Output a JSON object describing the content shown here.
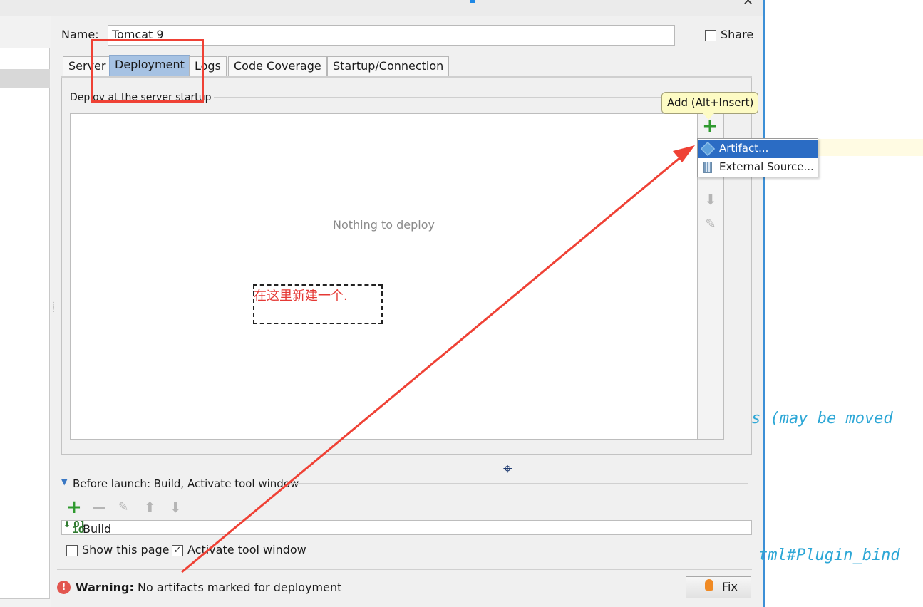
{
  "dialog": {
    "name_label": "Name:",
    "name_value": "Tomcat 9",
    "share_label": "Share",
    "share_checked": false
  },
  "tabs": [
    {
      "label": "Server",
      "active": false
    },
    {
      "label": "Deployment",
      "active": true
    },
    {
      "label": "Logs",
      "active": false
    },
    {
      "label": "Code Coverage",
      "active": false
    },
    {
      "label": "Startup/Connection",
      "active": false
    }
  ],
  "deployment": {
    "section_title": "Deploy at the server startup",
    "empty_text": "Nothing to deploy",
    "tooltip": "Add (Alt+Insert)",
    "add_menu": [
      "Artifact...",
      "External Source..."
    ],
    "annotation": "在这里新建一个."
  },
  "before_launch": {
    "label": "Before launch: Build, Activate tool window",
    "tasks": [
      "Build"
    ],
    "show_page_label": "Show this page",
    "show_page_checked": false,
    "activate_label": "Activate tool window",
    "activate_checked": true
  },
  "footer": {
    "warning_prefix": "Warning:",
    "warning_text": "No artifacts marked for deployment",
    "fix_label": "Fix"
  },
  "editor": {
    "line1": "s (may be moved",
    "line2": "tml#Plugin_bind"
  },
  "colors": {
    "accent_blue": "#2b6cc4",
    "active_tab": "#a6c2e3",
    "annotation_red": "#ef4135",
    "add_green": "#2f9a2f",
    "code_cyan": "#2da7d6"
  }
}
